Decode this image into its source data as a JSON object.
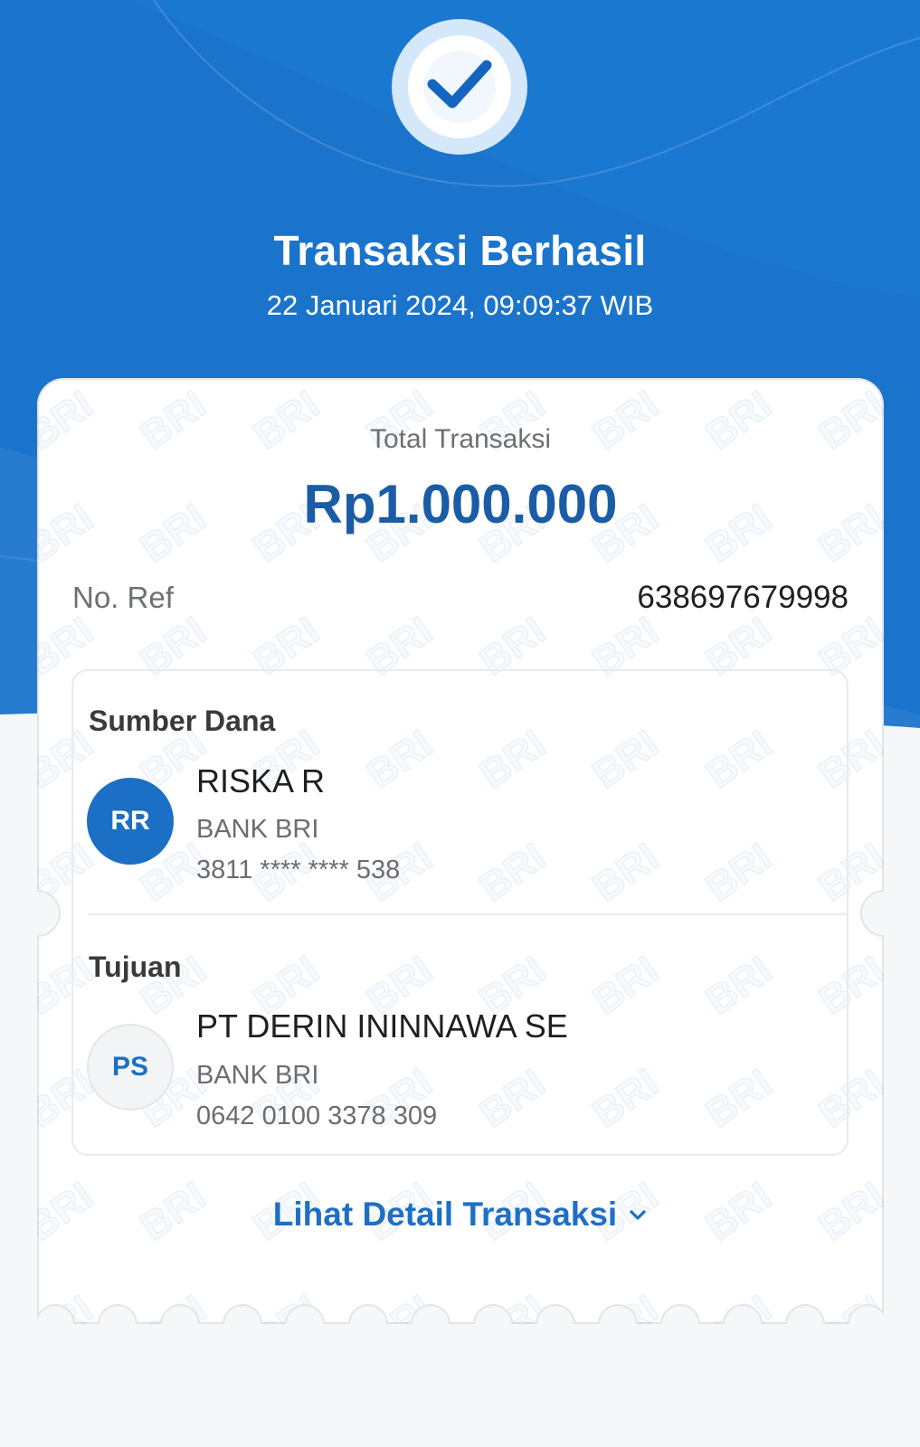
{
  "header": {
    "title": "Transaksi Berhasil",
    "datetime": "22 Januari 2024, 09:09:37 WIB",
    "status_icon": "check-icon"
  },
  "summary": {
    "total_label": "Total Transaksi",
    "total_amount": "Rp1.000.000",
    "ref_label": "No. Ref",
    "ref_value": "638697679998"
  },
  "source": {
    "section_label": "Sumber Dana",
    "initials": "RR",
    "name": "RISKA R",
    "bank": "BANK BRI",
    "account": "3811 **** **** 538"
  },
  "destination": {
    "section_label": "Tujuan",
    "initials": "PS",
    "name": "PT DERIN ININNAWA SE",
    "bank": "BANK BRI",
    "account": "0642 0100 3378 309"
  },
  "detail_link": {
    "label": "Lihat Detail Transaksi",
    "icon": "chevron-down-icon"
  },
  "watermark": "BRI",
  "colors": {
    "header_blue": "#1b74cc",
    "amount": "#1b5ca6",
    "link": "#1f6fc5",
    "avatar_source": "#1b6fc5",
    "background": "#f5f7f8"
  }
}
